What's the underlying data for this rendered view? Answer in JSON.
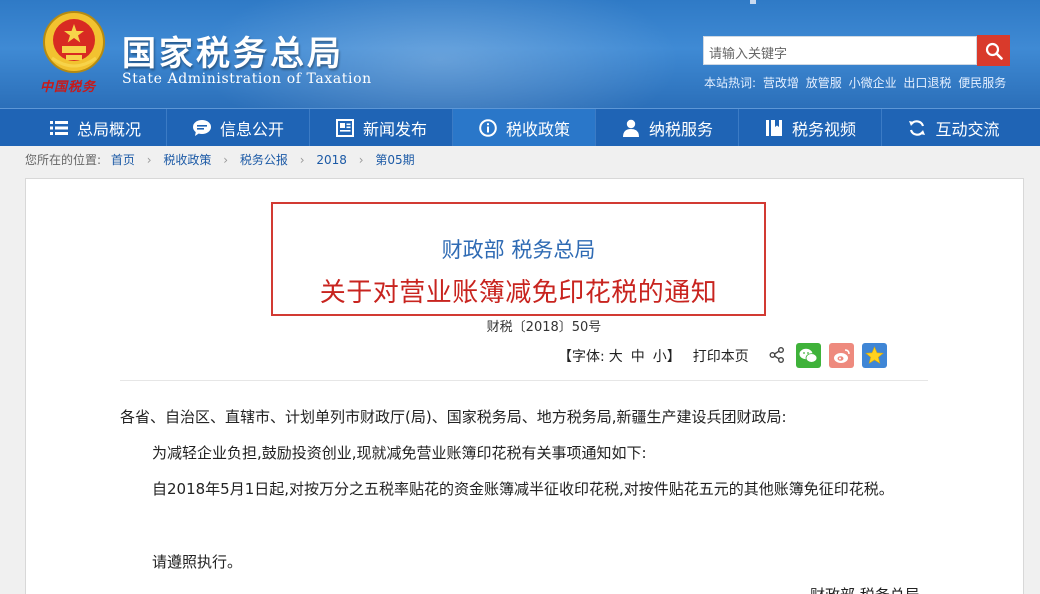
{
  "header": {
    "emblem_caption": "中国税务",
    "site_title": "国家税务总局",
    "site_subtitle": "State Administration of Taxation",
    "search_placeholder": "请输入关键字",
    "hot_label": "本站热词:",
    "hot_words": [
      "营改增",
      "放管服",
      "小微企业",
      "出口退税",
      "便民服务"
    ]
  },
  "nav": {
    "items": [
      {
        "label": "总局概况",
        "icon": "menu-icon"
      },
      {
        "label": "信息公开",
        "icon": "chat-bubble-icon"
      },
      {
        "label": "新闻发布",
        "icon": "newspaper-icon"
      },
      {
        "label": "税收政策",
        "icon": "info-circle-icon",
        "active": true
      },
      {
        "label": "纳税服务",
        "icon": "person-icon"
      },
      {
        "label": "税务视频",
        "icon": "book-icon"
      },
      {
        "label": "互动交流",
        "icon": "refresh-icon"
      }
    ]
  },
  "breadcrumb": {
    "prefix": "您所在的位置:",
    "items": [
      "首页",
      "税收政策",
      "税务公报",
      "2018",
      "第05期"
    ]
  },
  "article": {
    "title_line1": "财政部 税务总局",
    "title_line2": "关于对营业账簿减免印花税的通知",
    "doc_number": "财税〔2018〕50号",
    "font_label": "【字体:",
    "font_large": "大",
    "font_medium": "中",
    "font_small": "小】",
    "print_label": "打印本页",
    "paragraphs": [
      "各省、自治区、直辖市、计划单列市财政厅(局)、国家税务局、地方税务局,新疆生产建设兵团财政局:",
      "为减轻企业负担,鼓励投资创业,现就减免营业账簿印花税有关事项通知如下:",
      "自2018年5月1日起,对按万分之五税率贴花的资金账簿减半征收印花税,对按件贴花五元的其他账簿免征印花税。",
      "请遵照执行。"
    ],
    "signature": "财政部 税务总局"
  },
  "colors": {
    "header_blue": "#2f7ac6",
    "nav_blue": "#1f64b5",
    "title_blue": "#2f6bb4",
    "title_red": "#c8241f",
    "search_red": "#d93a2b"
  }
}
